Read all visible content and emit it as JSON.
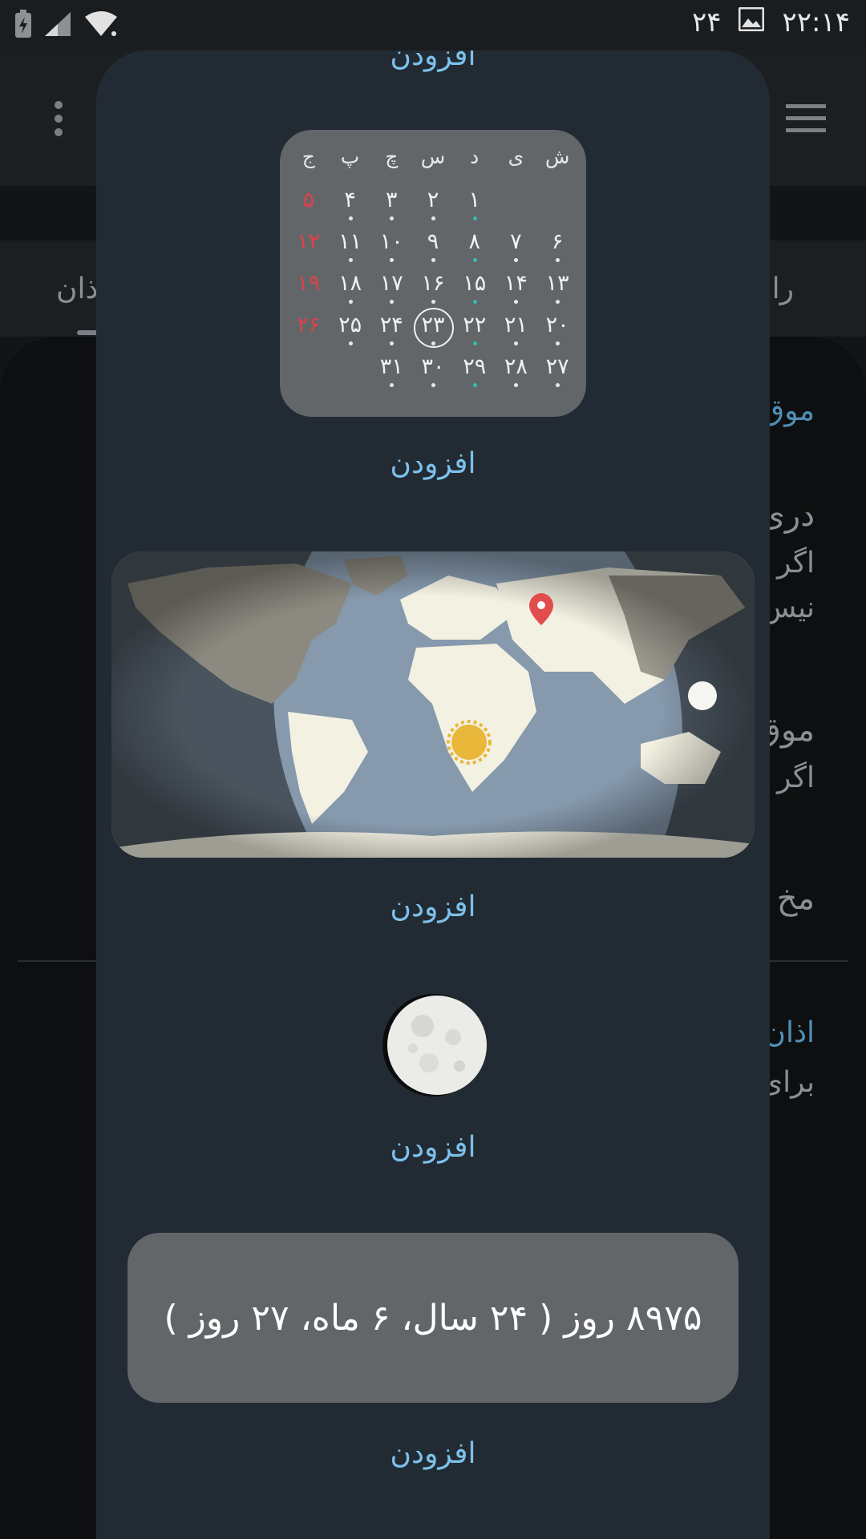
{
  "status_bar": {
    "time": "۲۲:۱۴",
    "notification_count": "۲۴"
  },
  "background": {
    "tabs": {
      "left": "ذان",
      "right": "راب"
    },
    "texts": [
      "موق",
      "دری",
      "اگر",
      "نیس",
      "موق",
      "اگر",
      "مخ",
      "اذان",
      "برای"
    ]
  },
  "dialog": {
    "top_add_label": "افزودن",
    "calendar": {
      "weekdays": [
        "ش",
        "ی",
        "د",
        "س",
        "چ",
        "پ",
        "ج"
      ],
      "weeks": [
        [
          "",
          "",
          "۱",
          "۲",
          "۳",
          "۴",
          "۵"
        ],
        [
          "۶",
          "۷",
          "۸",
          "۹",
          "۱۰",
          "۱۱",
          "۱۲"
        ],
        [
          "۱۳",
          "۱۴",
          "۱۵",
          "۱۶",
          "۱۷",
          "۱۸",
          "۱۹"
        ],
        [
          "۲۰",
          "۲۱",
          "۲۲",
          "۲۳",
          "۲۴",
          "۲۵",
          "۲۶"
        ],
        [
          "۲۷",
          "۲۸",
          "۲۹",
          "۳۰",
          "۳۱",
          "",
          ""
        ]
      ],
      "today": "۲۳",
      "accent_holiday": "#e0414b",
      "accent_event": "#2fc0b0"
    },
    "calendar_add_label": "افزودن",
    "map_add_label": "افزودن",
    "moon_add_label": "افزودن",
    "age_text": "۸۹۷۵ روز ( ۲۴ سال، ۶ ماه، ۲۷ روز )",
    "age_add_label": "افزودن"
  }
}
